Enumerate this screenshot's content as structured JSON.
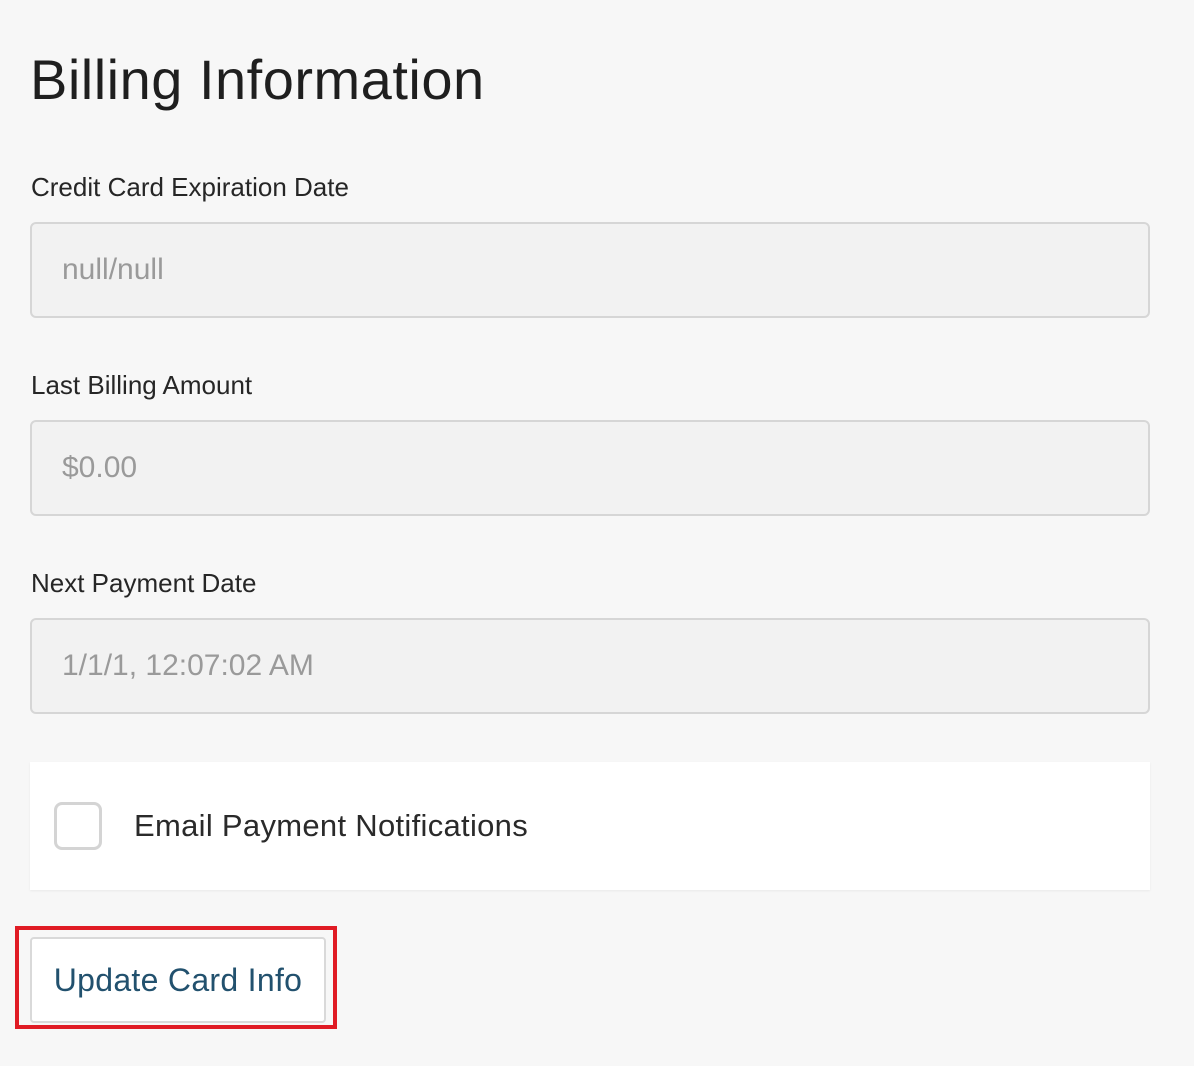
{
  "page": {
    "title": "Billing Information"
  },
  "fields": {
    "expiration": {
      "label": "Credit Card Expiration Date",
      "value": "null/null"
    },
    "last_amount": {
      "label": "Last Billing Amount",
      "value": "$0.00"
    },
    "next_payment": {
      "label": "Next Payment Date",
      "value": "1/1/1, 12:07:02 AM"
    }
  },
  "notifications": {
    "label": "Email Payment Notifications",
    "checked": false
  },
  "actions": {
    "update_label": "Update Card Info"
  },
  "colors": {
    "button_text": "#22516e",
    "highlight": "#e01b24"
  }
}
